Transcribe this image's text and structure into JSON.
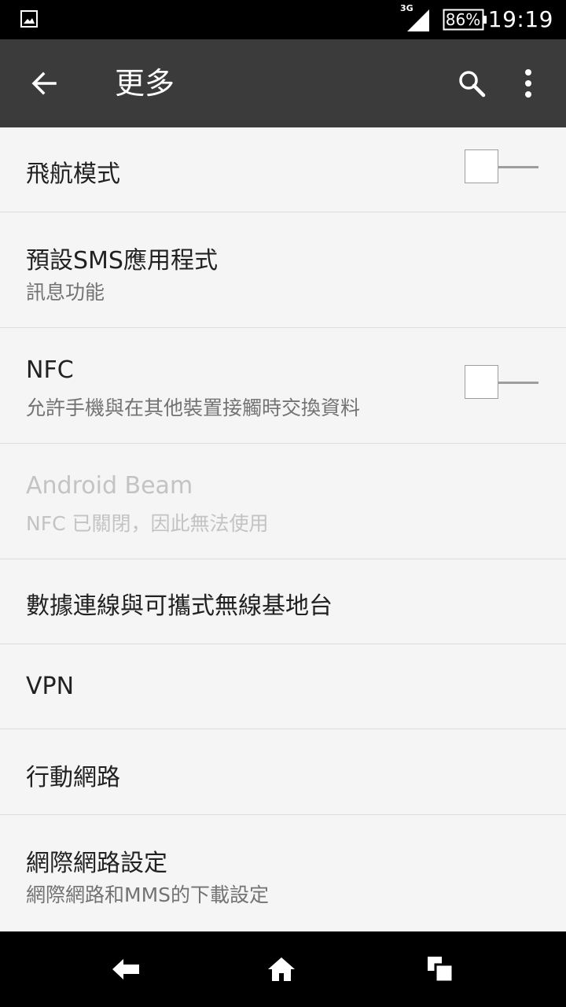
{
  "status_bar": {
    "network_type": "3G",
    "battery": "86%",
    "time": "19:19",
    "icons": [
      "gallery-icon",
      "signal-icon",
      "battery-icon"
    ]
  },
  "app_bar": {
    "title": "更多",
    "icons": [
      "back-arrow-icon",
      "search-icon",
      "overflow-menu-icon"
    ]
  },
  "settings": {
    "airplane_mode": {
      "label": "飛航模式",
      "enabled": false
    },
    "default_sms": {
      "label": "預設SMS應用程式",
      "summary": "訊息功能"
    },
    "nfc": {
      "label": "NFC",
      "summary": "允許手機與在其他裝置接觸時交換資料",
      "enabled": false
    },
    "android_beam": {
      "label": "Android Beam",
      "summary": "NFC 已關閉，因此無法使用",
      "disabled": true
    },
    "tethering": {
      "label": "數據連線與可攜式無線基地台"
    },
    "vpn": {
      "label": "VPN"
    },
    "mobile_network": {
      "label": "行動網路"
    },
    "internet_settings": {
      "label": "網際網路設定",
      "summary": "網際網路和MMS的下載設定"
    }
  },
  "nav_bar": {
    "icons": [
      "back-icon",
      "home-icon",
      "recents-icon"
    ]
  },
  "colors": {
    "app_bar_bg": "#3b3b3b",
    "list_bg": "#f5f5f5",
    "primary_text": "#212121",
    "secondary_text": "#737373",
    "disabled_text": "#c3c3c3"
  }
}
